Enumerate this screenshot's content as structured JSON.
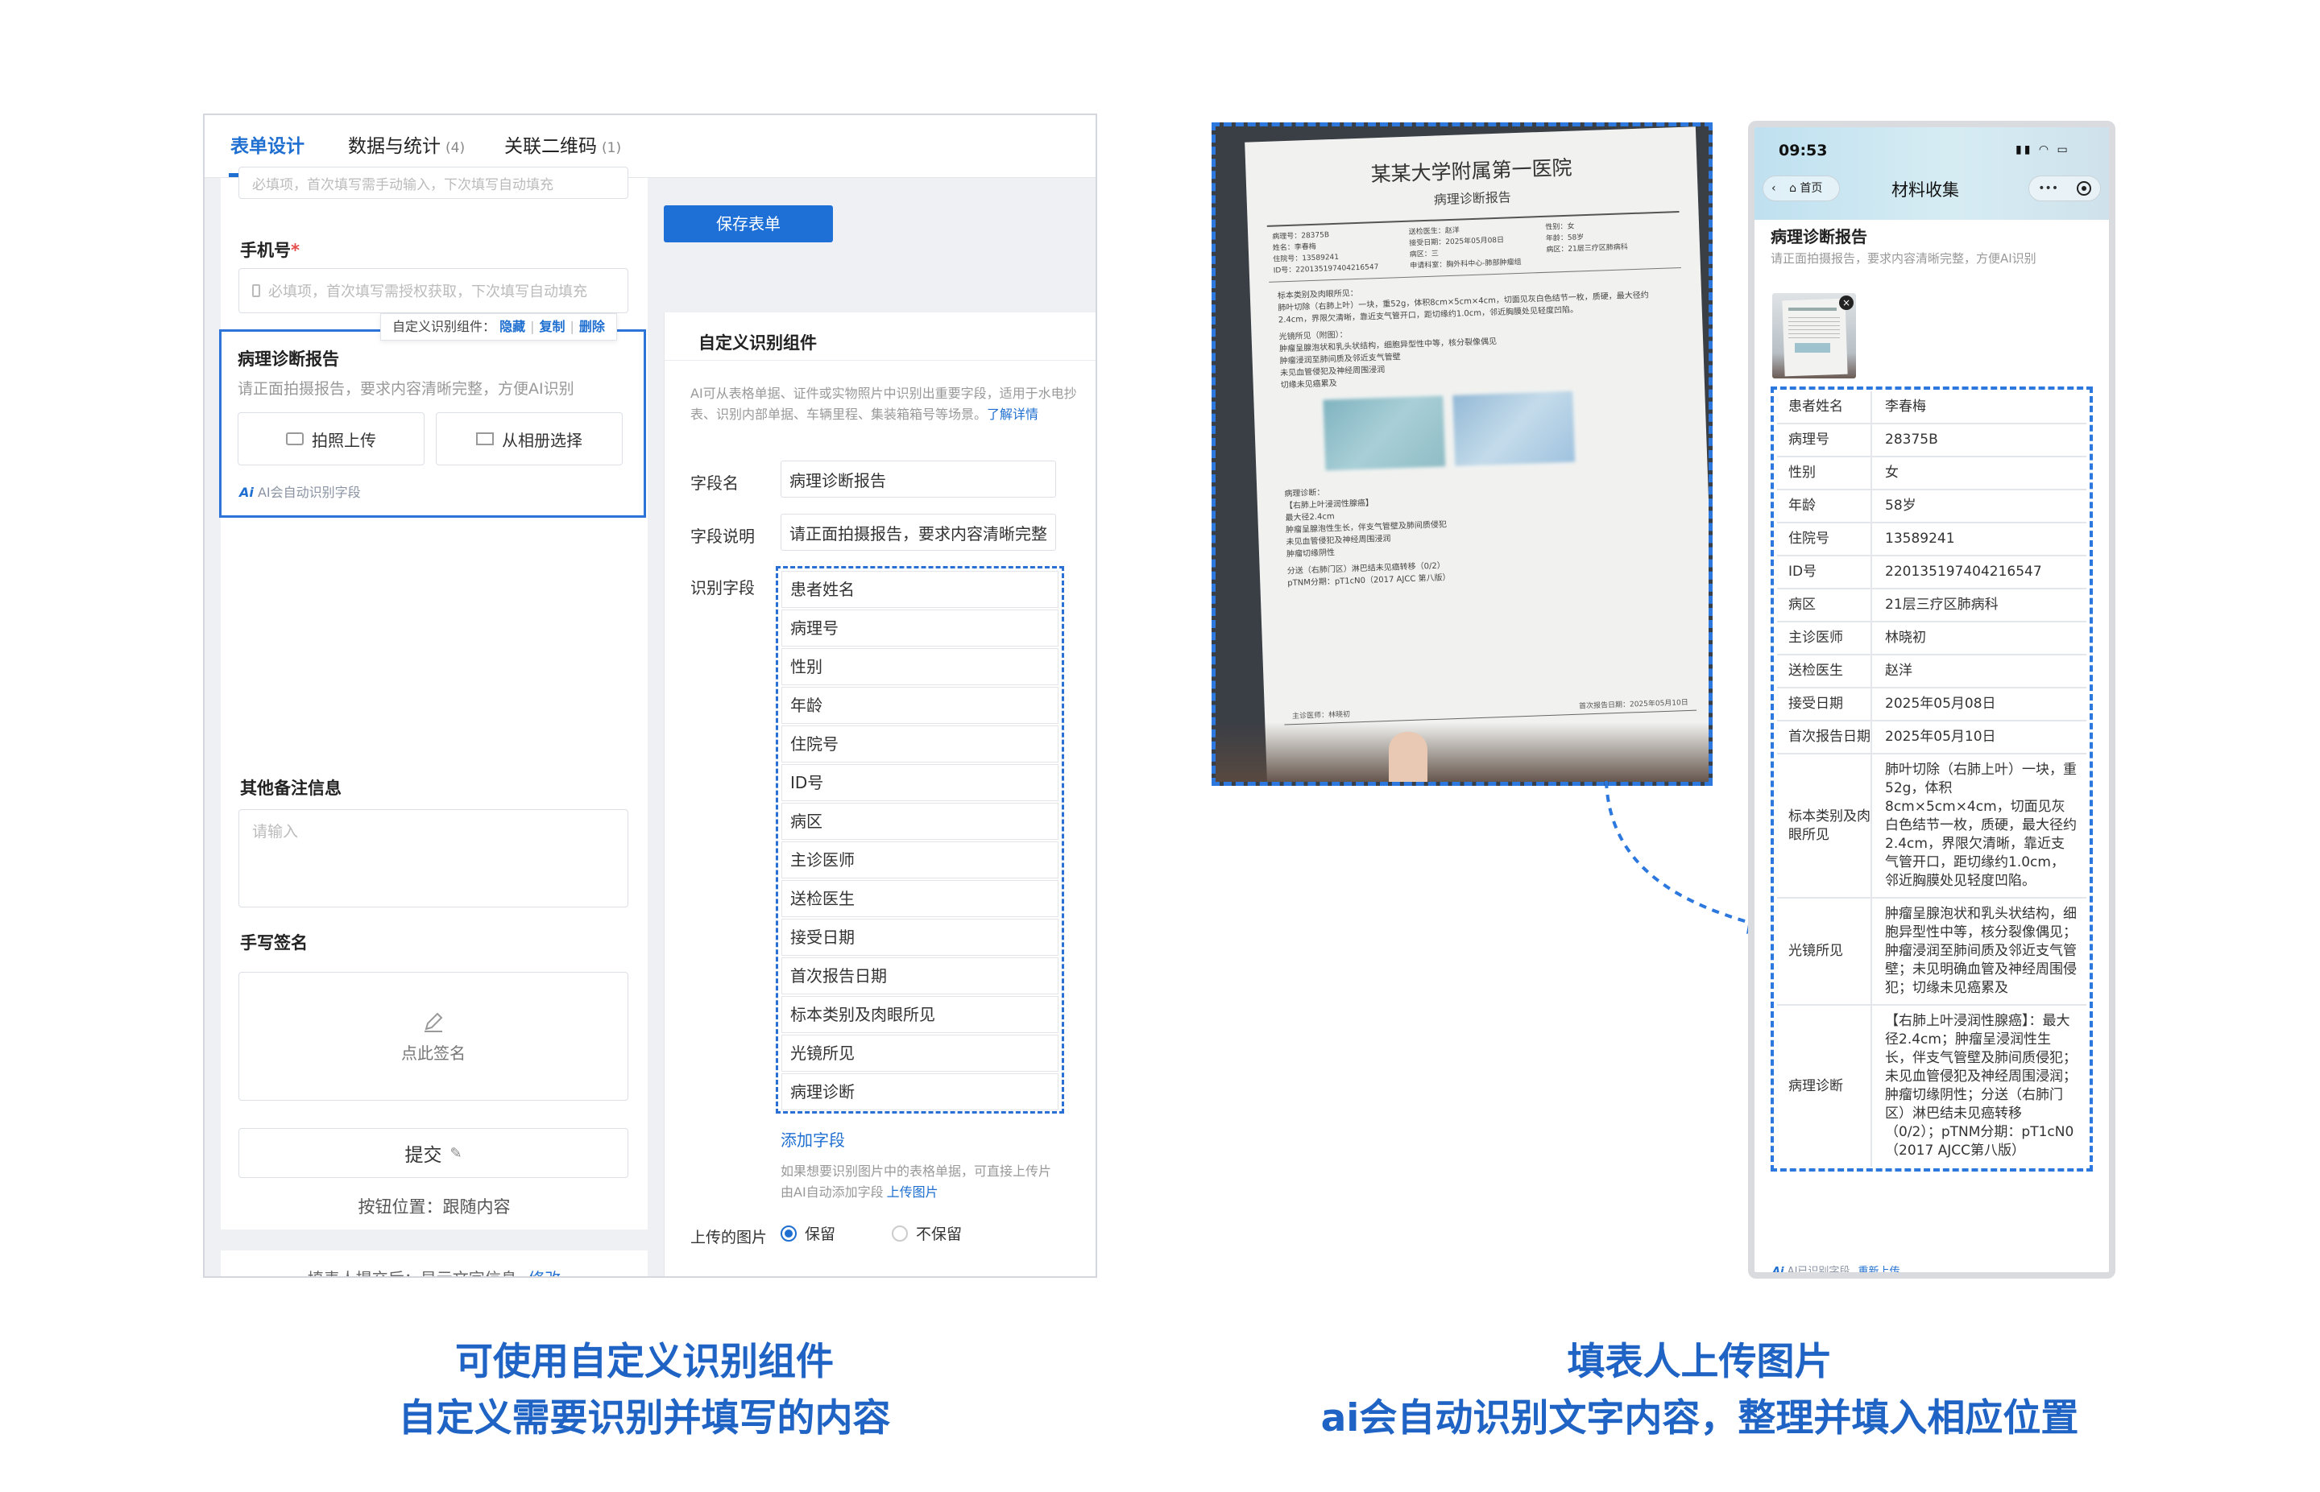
{
  "editor": {
    "tabs": [
      {
        "label": "表单设计",
        "count": ""
      },
      {
        "label": "数据与统计",
        "count": "(4)"
      },
      {
        "label": "关联二维码",
        "count": "(1)"
      }
    ],
    "save_button": "保存表单",
    "top_field_hint": "必填项，首次填写需手动输入，下次填写自动填充",
    "phone_label": "手机号",
    "phone_required": "*",
    "phone_placeholder": "必填项，首次填写需授权获取，下次填写自动填充",
    "custom_toolbar": {
      "prefix": "自定义识别组件：",
      "hide": "隐藏",
      "copy": "复制",
      "delete": "删除",
      "sep": "|"
    },
    "custom_title": "病理诊断报告",
    "custom_desc": "请正面拍摄报告，要求内容清晰完整，方便AI识别",
    "photo_button": "拍照上传",
    "album_button": "从相册选择",
    "ai_tag": "AI会自动识别字段",
    "remark_label": "其他备注信息",
    "remark_placeholder": "请输入",
    "sign_label": "手写签名",
    "sign_hint": "点此签名",
    "submit_button": "提交",
    "button_position": "按钮位置：跟随内容",
    "after_submit": "填表人提交后：显示文字信息",
    "after_submit_edit": "修改"
  },
  "panel": {
    "title": "自定义识别组件",
    "intro": "AI可从表格单据、证件或实物照片中识别出重要字段，适用于水电抄表、识别内部单据、车辆里程、集装箱箱号等场景。",
    "intro_link": "了解详情",
    "field_name_label": "字段名",
    "field_name_value": "病理诊断报告",
    "field_desc_label": "字段说明",
    "field_desc_value": "请正面拍摄报告，要求内容清晰完整",
    "recognize_label": "识别字段",
    "fields": [
      "患者姓名",
      "病理号",
      "性别",
      "年龄",
      "住院号",
      "ID号",
      "病区",
      "主诊医师",
      "送检医生",
      "接受日期",
      "首次报告日期",
      "标本类别及肉眼所见",
      "光镜所见",
      "病理诊断"
    ],
    "add_field": "添加字段",
    "hint": "如果想要识别图片中的表格单据，可直接上传片由AI自动添加字段",
    "hint_link": "上传图片",
    "uploaded_label": "上传的图片",
    "keep": "保留",
    "not_keep": "不保留"
  },
  "report": {
    "hospital": "某某大学附属第一医院",
    "title": "病理诊断报告",
    "lines": [
      "病理号：28375B",
      "姓名：李春梅",
      "住院号：13589241",
      "ID号：220135197404216547",
      "送检医生：赵洋",
      "接受日期：2025年05月08日",
      "病区：三",
      "申请科室：胸外科中心-肺部肿瘤组",
      "性别：女",
      "年龄：58岁",
      "病区：21层三疗区肺病科"
    ],
    "gross_title": "标本类别及肉眼所见：",
    "gross_text": "肺叶切除（右肺上叶）一块，重52g，体积8cm×5cm×4cm，切面见灰白色结节一枚，质硬，最大径约2.4cm，界限欠清晰，靠近支气管开口，距切缘约1.0cm，邻近胸膜处见轻度凹陷。",
    "micro_title": "光镜所见（附图）：",
    "micro_items": [
      "肿瘤呈腺泡状和乳头状结构，细胞异型性中等，核分裂像偶见",
      "肿瘤浸润至肺间质及邻近支气管壁",
      "未见血管侵犯及神经周围浸润",
      "切缘未见癌累及"
    ],
    "diag_title": "病理诊断：",
    "diag_items": [
      "【右肺上叶浸润性腺癌】",
      "最大径2.4cm",
      "肿瘤呈腺泡性生长，伴支气管壁及肺间质侵犯",
      "未见血管侵犯及神经周围浸润",
      "肿瘤切缘阴性"
    ],
    "lymph": "分送（右肺门区）淋巴结未见癌转移（0/2）",
    "ptnm": "pTNM分期：pT1cN0（2017 AJCC 第八版）",
    "doctor": "主诊医师：林晓初",
    "report_date": "首次报告日期：2025年05月10日"
  },
  "phone": {
    "time": "09:53",
    "home": "首页",
    "title": "材料收集",
    "more": "•••",
    "section_title": "病理诊断报告",
    "section_desc": "请正面拍摄报告，要求内容清晰完整，方便AI识别",
    "rows": [
      {
        "k": "患者姓名",
        "v": "李春梅"
      },
      {
        "k": "病理号",
        "v": "28375B"
      },
      {
        "k": "性别",
        "v": "女"
      },
      {
        "k": "年龄",
        "v": "58岁"
      },
      {
        "k": "住院号",
        "v": "13589241"
      },
      {
        "k": "ID号",
        "v": "220135197404216547"
      },
      {
        "k": "病区",
        "v": "21层三疗区肺病科"
      },
      {
        "k": "主诊医师",
        "v": "林晓初"
      },
      {
        "k": "送检医生",
        "v": "赵洋"
      },
      {
        "k": "接受日期",
        "v": "2025年05月08日"
      },
      {
        "k": "首次报告日期",
        "v": "2025年05月10日"
      },
      {
        "k": "标本类别及肉眼所见",
        "v": "肺叶切除（右肺上叶）一块，重52g，体积8cm×5cm×4cm，切面见灰白色结节一枚，质硬，最大径约2.4cm，界限欠清晰，靠近支气管开口，距切缘约1.0cm，邻近胸膜处见轻度凹陷。"
      },
      {
        "k": "光镜所见",
        "v": "肿瘤呈腺泡状和乳头状结构，细胞异型性中等，核分裂像偶见；肿瘤浸润至肺间质及邻近支气管壁；未见明确血管及神经周围侵犯；切缘未见癌累及"
      },
      {
        "k": "病理诊断",
        "v": "【右肺上叶浸润性腺癌】：最大径2.4cm；肿瘤呈浸润性生长，伴支气管壁及肺间质侵犯；未见血管侵犯及神经周围浸润；肿瘤切缘阴性；分送（右肺门区）淋巴结未见癌转移（0/2）；pTNM分期：pT1cN0（2017 AJCC第八版）"
      }
    ],
    "ai_tag": "AI已识别字段",
    "reupload": "重新上传"
  },
  "captions": {
    "left_line1": "可使用自定义识别组件",
    "left_line2": "自定义需要识别并填写的内容",
    "right_line1": "填表人上传图片",
    "right_line2": "ai会自动识别文字内容，整理并填入相应位置"
  },
  "colors": {
    "accent": "#1f6fd1",
    "caption": "#1f63c4",
    "dashed": "#2c78de"
  }
}
